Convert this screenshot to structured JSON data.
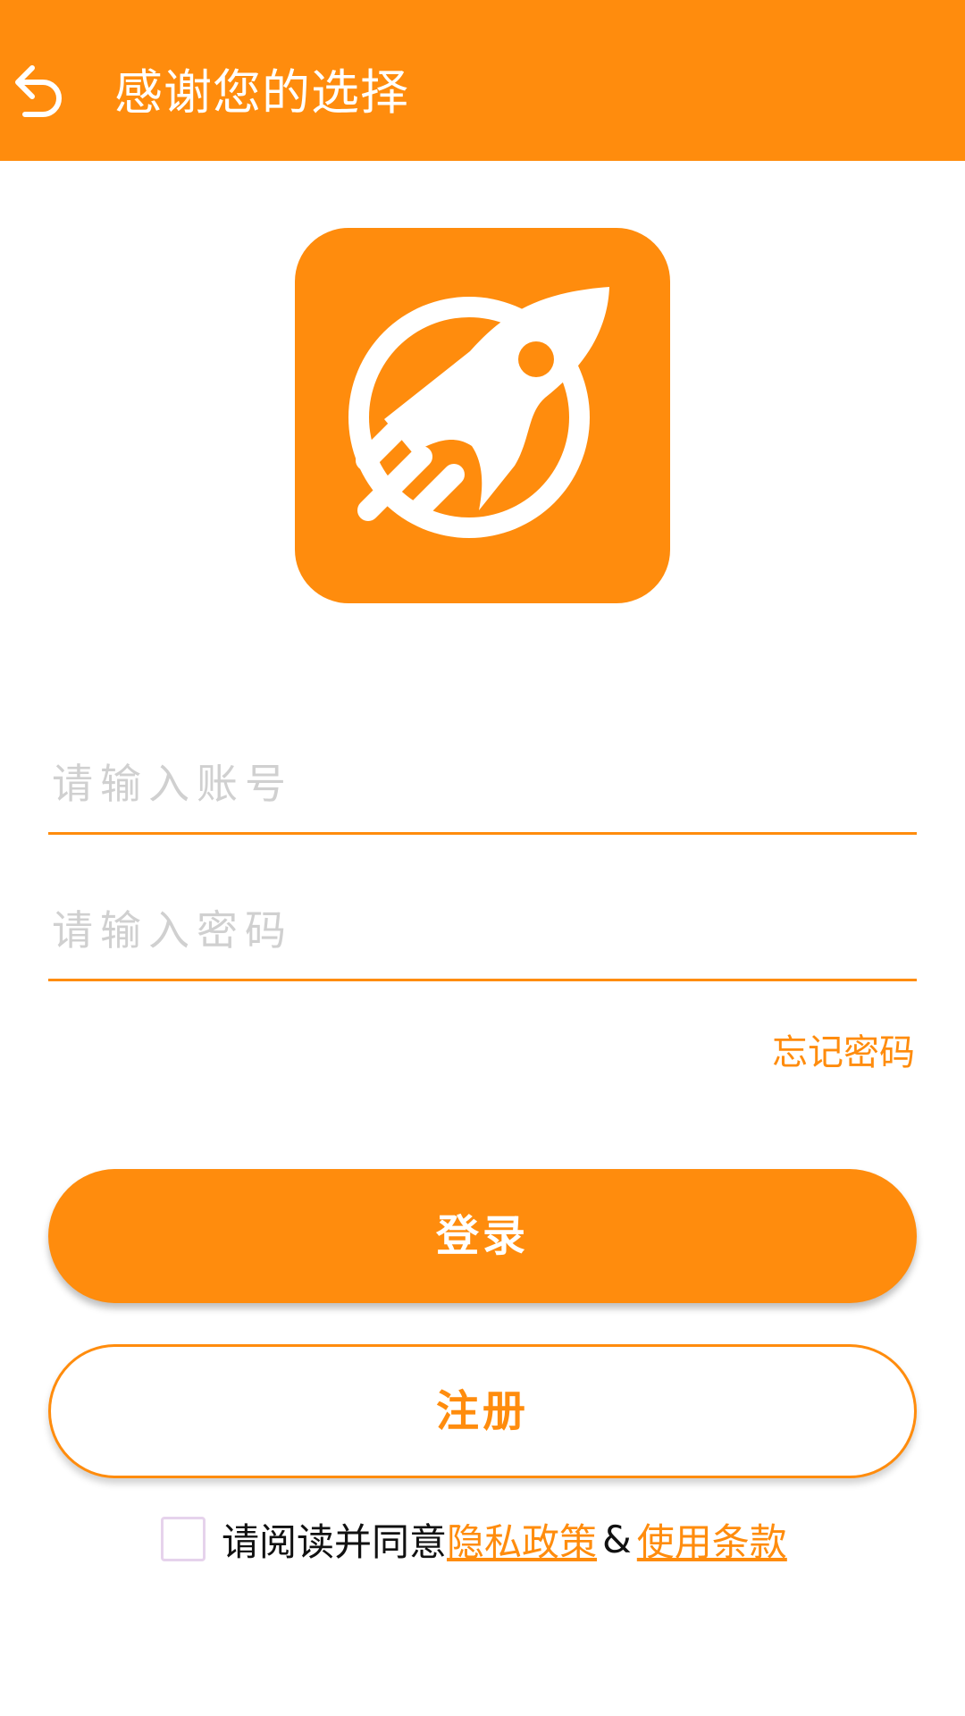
{
  "header": {
    "title": "感谢您的选择",
    "back_icon": "back-arrow-icon"
  },
  "logo": {
    "icon": "rocket-icon"
  },
  "form": {
    "account_placeholder": "请输入账号",
    "account_value": "",
    "password_placeholder": "请输入密码",
    "password_value": "",
    "forgot_label": "忘记密码"
  },
  "actions": {
    "login_label": "登录",
    "register_label": "注册"
  },
  "agreement": {
    "checked": false,
    "prefix": "请阅读并同意",
    "privacy_label": "隐私政策",
    "separator": "&",
    "terms_label": "使用条款"
  },
  "colors": {
    "accent": "#FF8C0D",
    "placeholder": "#D0D0D0",
    "checkbox_border": "#E6D3EC"
  }
}
